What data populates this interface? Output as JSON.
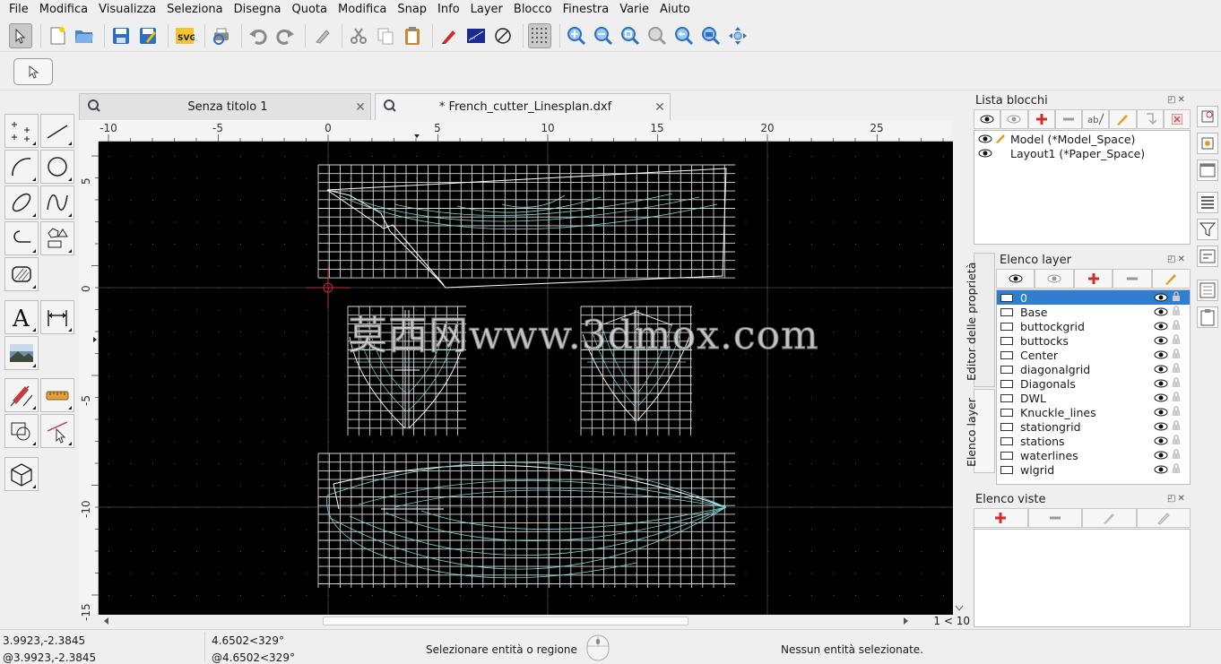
{
  "menubar": {
    "items": [
      "File",
      "Modifica",
      "Visualizza",
      "Seleziona",
      "Disegna",
      "Quota",
      "Modifica",
      "Snap",
      "Info",
      "Layer",
      "Blocco",
      "Finestra",
      "Varie",
      "Aiuto"
    ]
  },
  "toolbar": {
    "icons": [
      "select-pointer-icon",
      "new-file-icon",
      "open-folder-icon",
      "save-icon",
      "save-as-icon",
      "export-svg-icon",
      "print-preview-icon",
      "undo-icon",
      "redo-icon",
      "eraser-icon",
      "cut-icon",
      "copy-icon",
      "paste-icon",
      "pen-icon",
      "background-color-icon",
      "no-draft-icon",
      "grid-icon",
      "zoom-in-icon",
      "zoom-out-icon",
      "zoom-auto-icon",
      "zoom-pan-icon",
      "zoom-previous-icon",
      "zoom-window-icon",
      "zoom-redraw-icon"
    ]
  },
  "tabs": [
    {
      "label": "Senza titolo 1",
      "close": "✕"
    },
    {
      "label": "* French_cutter_Linesplan.dxf",
      "close": "✕"
    }
  ],
  "ruler": {
    "h": [
      "-10",
      "-5",
      "0",
      "5",
      "10",
      "15",
      "20",
      "25"
    ],
    "v": [
      "5",
      "0",
      "-5",
      "-10",
      "-15"
    ]
  },
  "canvas": {
    "watermark": "莫西网www.3dmox.com",
    "background": "#000000",
    "grid_color": "#ffffff",
    "hull_color": "#7fd6d6"
  },
  "scroll": {
    "ratio": "1 < 10"
  },
  "status": {
    "abs_coord": "3.9923,-2.3845",
    "rel_coord": "@3.9923,-2.3845",
    "abs_polar": "4.6502<329°",
    "rel_polar": "@4.6502<329°",
    "prompt": "Selezionare entità o regione",
    "selection": "Nessun entità selezionate."
  },
  "blocks": {
    "title": "Lista blocchi",
    "rows": [
      {
        "name": "Model (*Model_Space)"
      },
      {
        "name": "Layout1 (*Paper_Space)"
      }
    ]
  },
  "layers": {
    "title": "Elenco layer",
    "rows": [
      "0",
      "Base",
      "buttockgrid",
      "buttocks",
      "Center",
      "diagonalgrid",
      "Diagonals",
      "DWL",
      "Knuckle_lines",
      "stationgrid",
      "stations",
      "waterlines",
      "wlgrid"
    ],
    "selected": "0",
    "selected_color": "#2f7fd0"
  },
  "side_tabs": {
    "props": "Editor delle proprietà",
    "layers": "Elenco layer"
  },
  "views": {
    "title": "Elenco viste"
  }
}
